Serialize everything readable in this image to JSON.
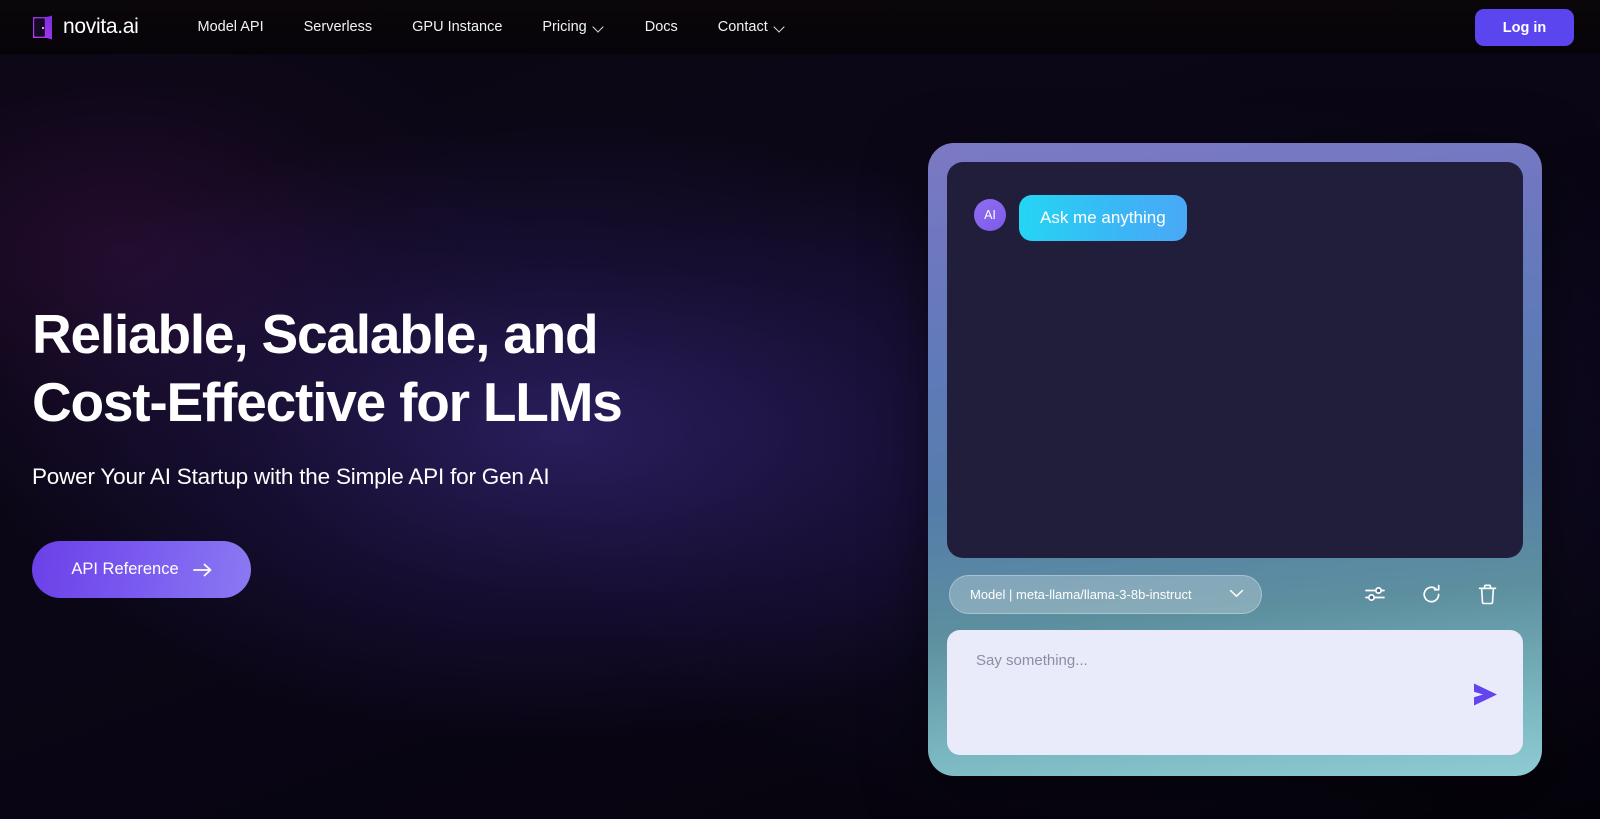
{
  "brand": {
    "name": "novita.ai",
    "logo_icon": "novita-door-logo-icon",
    "logo_color": "#a03cf0"
  },
  "nav": {
    "items": [
      {
        "label": "Model API",
        "has_dropdown": false
      },
      {
        "label": "Serverless",
        "has_dropdown": false
      },
      {
        "label": "GPU Instance",
        "has_dropdown": false
      },
      {
        "label": "Pricing",
        "has_dropdown": true,
        "dropdown_icon": "chevron-down-icon"
      },
      {
        "label": "Docs",
        "has_dropdown": false
      },
      {
        "label": "Contact",
        "has_dropdown": true,
        "dropdown_icon": "chevron-down-icon"
      }
    ],
    "login_label": "Log in",
    "login_color": "#5a45ef"
  },
  "hero": {
    "headline": "Reliable, Scalable, and Cost-Effective for LLMs",
    "subheadline": "Power Your AI Startup with the Simple API for Gen AI",
    "cta_label": "API Reference",
    "cta_icon": "arrow-right-icon",
    "cta_gradient_from": "#6a40e8",
    "cta_gradient_to": "#8b7af2"
  },
  "chat_panel": {
    "frame_gradient_from": "#7d79c4",
    "frame_gradient_to": "#8fcbd3",
    "messages_background": "#211e3b",
    "messages": [
      {
        "avatar_label": "AI",
        "avatar_name": "ai-avatar",
        "text": "Ask me anything",
        "bubble_gradient_from": "#24d6f4",
        "bubble_gradient_to": "#4aa8f6"
      }
    ],
    "model_selector": {
      "label": "Model | meta-llama/llama-3-8b-instruct",
      "dropdown_icon": "chevron-down-icon"
    },
    "tools": [
      {
        "name": "settings-sliders-icon",
        "title": "Settings"
      },
      {
        "name": "refresh-icon",
        "title": "Refresh"
      },
      {
        "name": "trash-icon",
        "title": "Clear"
      }
    ],
    "composer": {
      "placeholder": "Say something...",
      "value": "",
      "send_icon": "send-arrow-icon",
      "send_color": "#6344ef",
      "background": "#e9ebfa"
    }
  }
}
